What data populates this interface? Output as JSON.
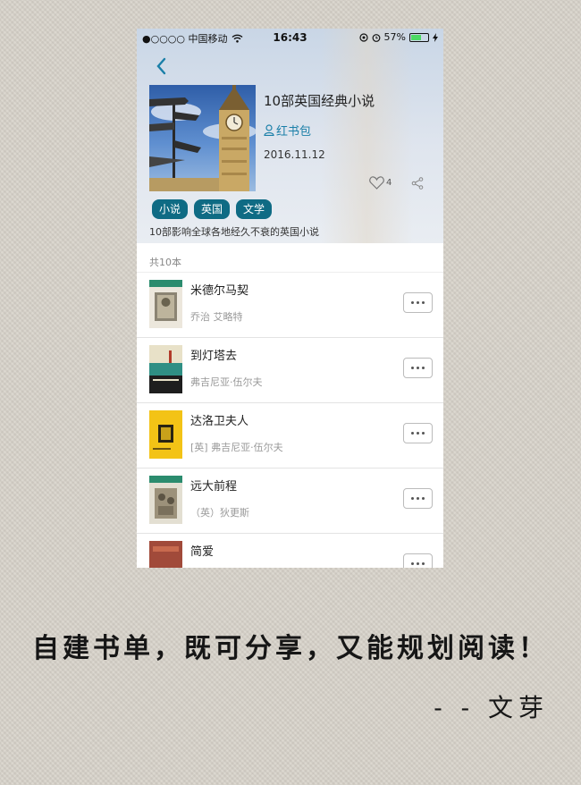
{
  "status_bar": {
    "carrier": "●○○○○ 中国移动",
    "time": "16:43",
    "battery": "57%",
    "battery_level": 0.57
  },
  "header": {
    "back_icon": "chevron-left-icon",
    "list_title": "10部英国经典小说",
    "author": "红书包",
    "date": "2016.11.12",
    "likes": "4",
    "share_icon": "share-icon"
  },
  "tags": [
    "小说",
    "英国",
    "文学"
  ],
  "description": "10部影响全球各地经久不衰的英国小说",
  "count_label": "共10本",
  "books": [
    {
      "title": "米德尔马契",
      "author": "乔治 艾略特",
      "cover_color": "#d8d2c4"
    },
    {
      "title": "到灯塔去",
      "author": "弗吉尼亚·伍尔夫",
      "cover_color": "#2f8f84"
    },
    {
      "title": "达洛卫夫人",
      "author": "[英] 弗吉尼亚·伍尔夫",
      "cover_color": "#f3c316"
    },
    {
      "title": "远大前程",
      "author": "（英）狄更斯",
      "cover_color": "#e3dfd2"
    },
    {
      "title": "简爱",
      "author": "",
      "cover_color": "#a14a3a"
    }
  ],
  "caption": "自建书单，既可分享，又能规划阅读！",
  "signature": "- - 文芽",
  "colors": {
    "accent": "#1a7fa8",
    "tag_bg": "#0f6b84",
    "background": "#d9d4cb"
  }
}
